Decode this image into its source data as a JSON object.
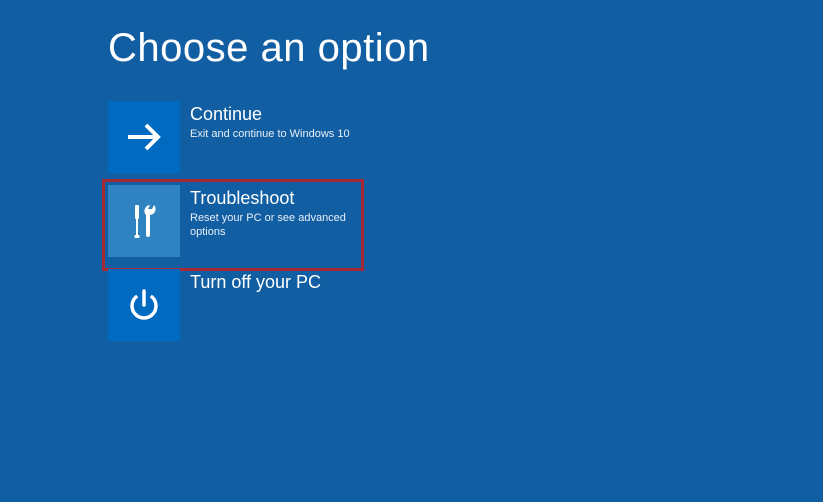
{
  "header": {
    "title": "Choose an option"
  },
  "options": {
    "continue": {
      "title": "Continue",
      "subtitle": "Exit and continue to Windows 10"
    },
    "troubleshoot": {
      "title": "Troubleshoot",
      "subtitle": "Reset your PC or see advanced options"
    },
    "turnoff": {
      "title": "Turn off your PC"
    }
  },
  "colors": {
    "background": "#115ea3",
    "tile_dark": "#006ac1",
    "tile_light": "#2f83c1",
    "highlight": "#a62b35"
  }
}
